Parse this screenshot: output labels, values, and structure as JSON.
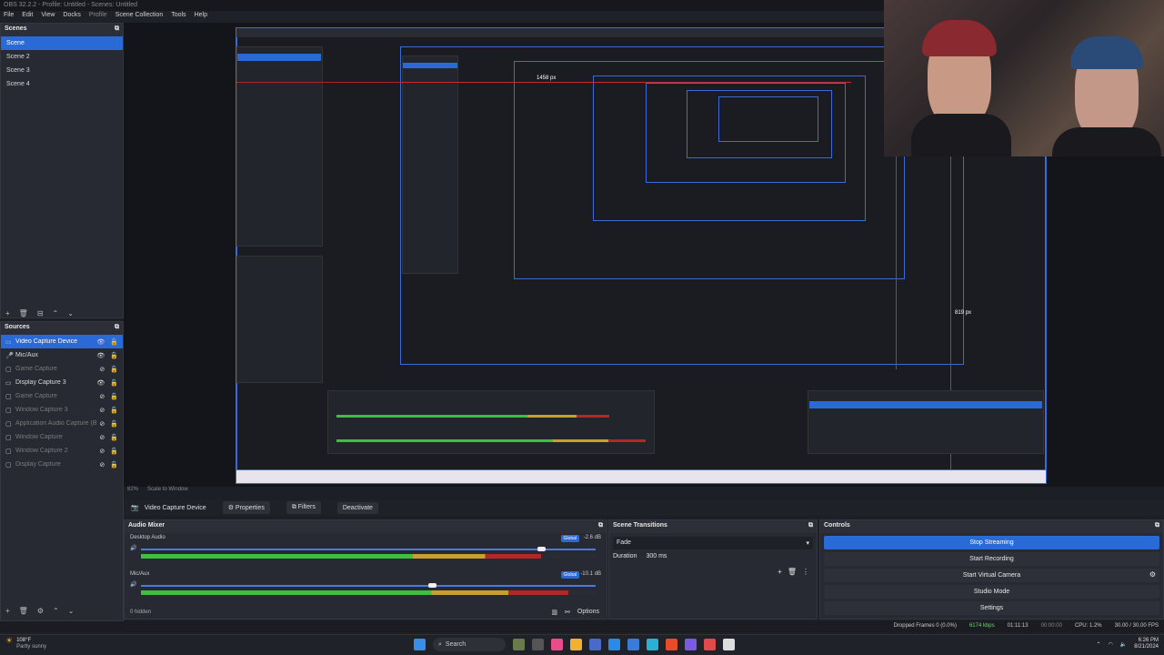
{
  "title": "OBS 32.2.2 - Profile: Untitled - Scenes: Untitled",
  "menu": [
    "File",
    "Edit",
    "View",
    "Docks",
    "Profile",
    "Scene Collection",
    "Tools",
    "Help"
  ],
  "scenes": {
    "title": "Scenes",
    "items": [
      "Scene",
      "Scene 2",
      "Scene 3",
      "Scene 4"
    ]
  },
  "sources": {
    "title": "Sources",
    "items": [
      {
        "name": "Video Capture Device",
        "visible": true
      },
      {
        "name": "Mic/Aux",
        "visible": true
      },
      {
        "name": "Game Capture",
        "visible": false
      },
      {
        "name": "Display Capture 3",
        "visible": true
      },
      {
        "name": "Game Capture",
        "visible": false
      },
      {
        "name": "Window Capture 3",
        "visible": false
      },
      {
        "name": "Application Audio Capture (BETA)",
        "visible": false
      },
      {
        "name": "Window Capture",
        "visible": false
      },
      {
        "name": "Window Capture 2",
        "visible": false
      },
      {
        "name": "Display Capture",
        "visible": false
      }
    ]
  },
  "preview": {
    "zoom": "82%",
    "scale_label": "Scale to Window",
    "px_label_1": "1458 px",
    "px_label_2": "819 px"
  },
  "source_toolbar": {
    "selected": "Video Capture Device",
    "properties": "Properties",
    "filters": "Filters",
    "deactivate": "Deactivate"
  },
  "mixer": {
    "title": "Audio Mixer",
    "channels": [
      {
        "name": "Desktop Audio",
        "db": "-2.6 dB",
        "badge": "Global",
        "level": 0.88,
        "volume": 0.88
      },
      {
        "name": "Mic/Aux",
        "db": "-10.1 dB",
        "badge": "Global",
        "level": 0.94,
        "volume": 0.64
      }
    ],
    "hidden": "0 hidden",
    "options": "Options"
  },
  "transitions": {
    "title": "Scene Transitions",
    "type": "Fade",
    "duration_label": "Duration",
    "duration": "300 ms"
  },
  "controls": {
    "title": "Controls",
    "buttons": [
      "Stop Streaming",
      "Start Recording",
      "Start Virtual Camera",
      "Studio Mode",
      "Settings"
    ]
  },
  "status": {
    "dropped": "Dropped Frames 0 (0.0%)",
    "bitrate": "6174 kbps",
    "stream_time": "01:11:13",
    "rec_time": "00:00:00",
    "cpu": "CPU: 1.2%",
    "fps": "30.00 / 30.00 FPS"
  },
  "taskbar": {
    "temp": "108°F",
    "weather": "Partly sunny",
    "search": "Search",
    "time": "6:26 PM",
    "date": "8/21/2024"
  },
  "colors": {
    "accent": "#2a6ad7",
    "live": "#d02828"
  }
}
